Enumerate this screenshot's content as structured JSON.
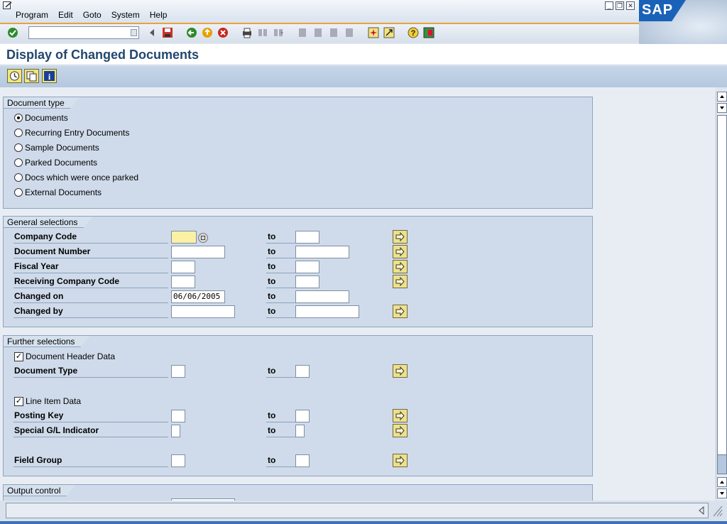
{
  "menu": [
    "Program",
    "Edit",
    "Goto",
    "System",
    "Help"
  ],
  "logo_text": "SAP",
  "window_buttons": [
    "minimize",
    "restore",
    "close"
  ],
  "toolbar": {
    "command_value": "",
    "icons": [
      "enter-icon",
      "back-icon",
      "save-icon",
      "green-back-icon",
      "exit-icon",
      "cancel-icon",
      "print-icon",
      "find-icon",
      "find-next-icon",
      "first-page-icon",
      "previous-page-icon",
      "next-page-icon",
      "last-page-icon",
      "create-session-icon",
      "shortcut-icon",
      "help-icon",
      "layout-icon"
    ]
  },
  "title": "Display of Changed Documents",
  "app_toolbar": [
    "execute-icon",
    "get-variant-icon",
    "info-icon"
  ],
  "document_type": {
    "title": "Document type",
    "options": [
      {
        "label": "Documents",
        "selected": true
      },
      {
        "label": "Recurring Entry Documents",
        "selected": false
      },
      {
        "label": "Sample Documents",
        "selected": false
      },
      {
        "label": "Parked Documents",
        "selected": false
      },
      {
        "label": "Docs which were once parked",
        "selected": false
      },
      {
        "label": "External Documents",
        "selected": false
      }
    ]
  },
  "general": {
    "title": "General selections",
    "to_label": "to",
    "rows": [
      {
        "label": "Company Code",
        "from": "",
        "to": ""
      },
      {
        "label": "Document Number",
        "from": "",
        "to": ""
      },
      {
        "label": "Fiscal Year",
        "from": "",
        "to": ""
      },
      {
        "label": "Receiving Company Code",
        "from": "",
        "to": ""
      },
      {
        "label": "Changed on",
        "from": "06/06/2005",
        "to": ""
      },
      {
        "label": "Changed by",
        "from": "",
        "to": ""
      }
    ]
  },
  "further": {
    "title": "Further selections",
    "header_check": {
      "label": "Document Header Data",
      "checked": true
    },
    "doc_type": {
      "label": "Document Type",
      "from": "",
      "to": ""
    },
    "line_check": {
      "label": "Line Item Data",
      "checked": true
    },
    "posting_key": {
      "label": "Posting Key",
      "from": "",
      "to": ""
    },
    "special_gl": {
      "label": "Special G/L Indicator",
      "from": "",
      "to": ""
    },
    "field_group": {
      "label": "Field Group",
      "from": "",
      "to": ""
    }
  },
  "output": {
    "title": "Output control"
  },
  "colors": {
    "accent": "#e9a23b",
    "title": "#22476f",
    "group_bg": "#cfdbea"
  }
}
